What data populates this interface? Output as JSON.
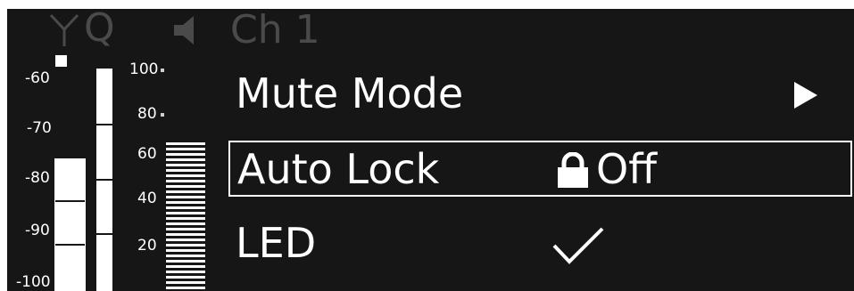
{
  "status_bar": {
    "antenna_icon": "antenna-icon",
    "diversity_label": "Q",
    "speaker_icon": "speaker-icon",
    "channel": "Ch 1",
    "dim_color": "#4a4a4a"
  },
  "rf_meter": {
    "scale_labels": [
      "-60",
      "-70",
      "-80",
      "-90",
      "-100"
    ],
    "level_db": -78,
    "peak_db": -58
  },
  "af_meter": {
    "scale_labels": [
      "100",
      "80",
      "60",
      "40",
      "20"
    ],
    "level": 65
  },
  "menu": {
    "items": [
      {
        "label": "Mute Mode",
        "indicator": "arrow-right-icon"
      },
      {
        "label": "Auto Lock",
        "value": "Off",
        "indicator": "lock-icon",
        "selected": true
      },
      {
        "label": "LED",
        "indicator": "checkmark-icon",
        "checked": true
      }
    ]
  },
  "colors": {
    "background": "#161616",
    "foreground": "#ffffff"
  }
}
